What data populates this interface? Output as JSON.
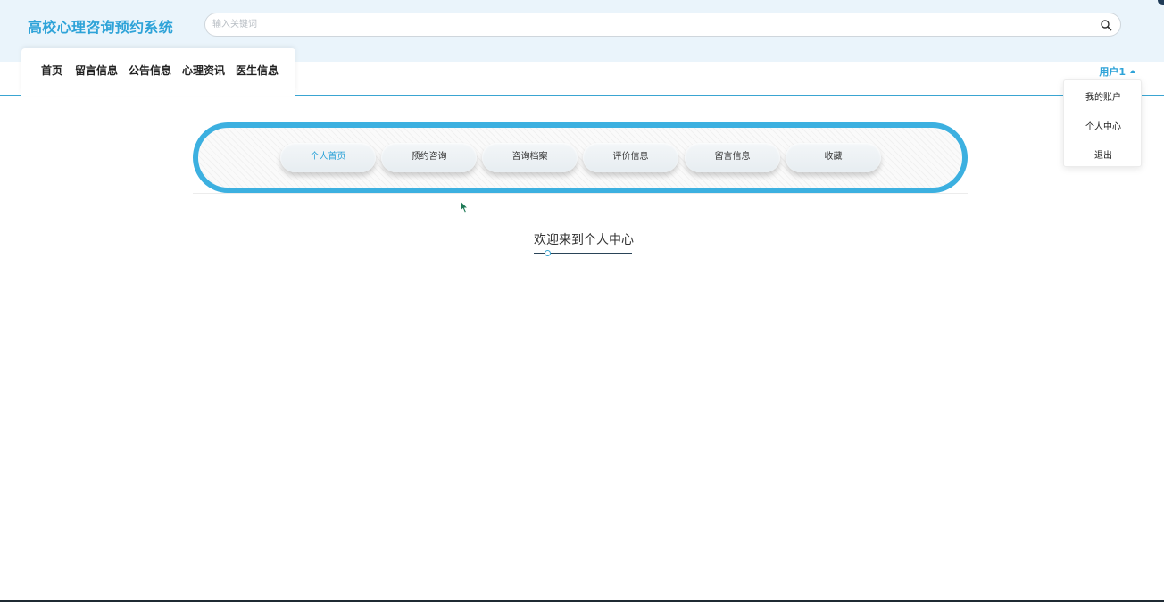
{
  "header": {
    "title": "高校心理咨询预约系统",
    "search": {
      "placeholder": "输入关键词",
      "value": ""
    }
  },
  "nav": {
    "items": [
      {
        "label": "首页"
      },
      {
        "label": "留言信息"
      },
      {
        "label": "公告信息"
      },
      {
        "label": "心理资讯"
      },
      {
        "label": "医生信息"
      }
    ]
  },
  "user_menu": {
    "label": "用户1",
    "items": [
      {
        "label": "我的账户"
      },
      {
        "label": "个人中心"
      },
      {
        "label": "退出"
      }
    ]
  },
  "tabs": {
    "active_index": 0,
    "items": [
      {
        "label": "个人首页"
      },
      {
        "label": "预约咨询"
      },
      {
        "label": "咨询档案"
      },
      {
        "label": "评价信息"
      },
      {
        "label": "留言信息"
      },
      {
        "label": "收藏"
      }
    ]
  },
  "main": {
    "welcome": "欢迎来到个人中心"
  },
  "colors": {
    "accent": "#2ea3d8",
    "frame_border": "#3cb0e0",
    "header_bg": "#eaf4fb"
  },
  "icons": {
    "search": "search-icon",
    "user_caret": "caret-up-icon",
    "cursor": "mouse-cursor-icon"
  }
}
